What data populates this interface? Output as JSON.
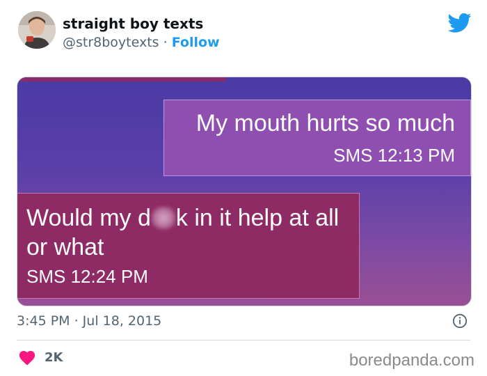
{
  "tweet": {
    "author_name": "straight boy texts",
    "handle": "@str8boytexts",
    "separator": " · ",
    "follow_label": "Follow",
    "timestamp": "3:45 PM · Jul 18, 2015",
    "like_count": "2K"
  },
  "media": {
    "sent_message": {
      "text": "My mouth hurts so much",
      "meta": "SMS 12:13 PM"
    },
    "received_message": {
      "text_before": "Would my d",
      "text_after": "k in it help at all or what",
      "meta": "SMS 12:24 PM"
    }
  },
  "watermark": "boredpanda.com",
  "icons": {
    "brand": "twitter-bird-icon",
    "info": "info-icon",
    "like": "heart-icon"
  },
  "colors": {
    "link_blue": "#1d9bf0",
    "heart": "#f91880",
    "sent_bubble": "#8f4fb0",
    "received_bubble": "#8e2a64"
  }
}
